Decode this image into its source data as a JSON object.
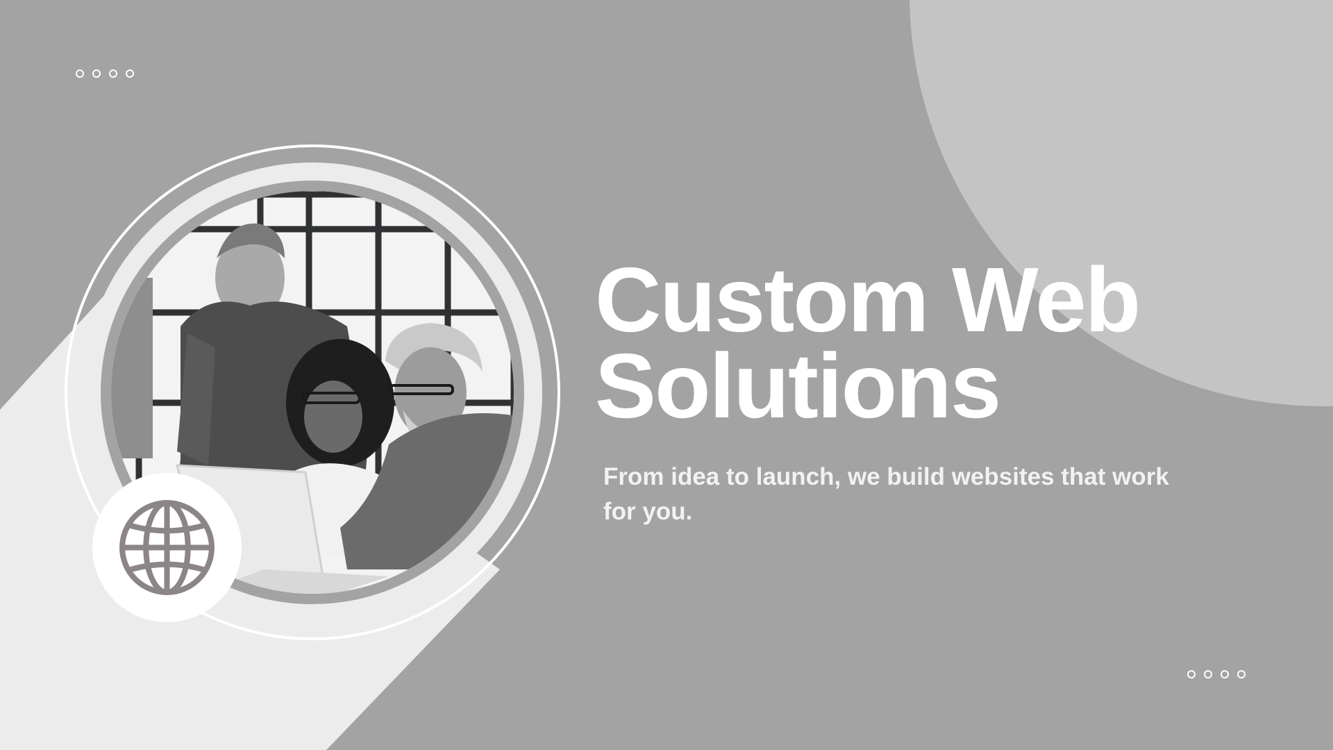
{
  "slide": {
    "title_line1": "Custom Web",
    "title_line2": "Solutions",
    "subtitle": "From idea to launch, we build websites that work for you."
  },
  "photo": {
    "description_icon": "photo-team-at-laptop"
  },
  "badge": {
    "icon": "globe-icon"
  },
  "colors": {
    "background": "#a3a3a3",
    "light_shape": "#ececec",
    "corner_circle": "#c4c4c4",
    "ring": "#ffffff",
    "icon": "#8c8585",
    "text": "#ffffff"
  }
}
